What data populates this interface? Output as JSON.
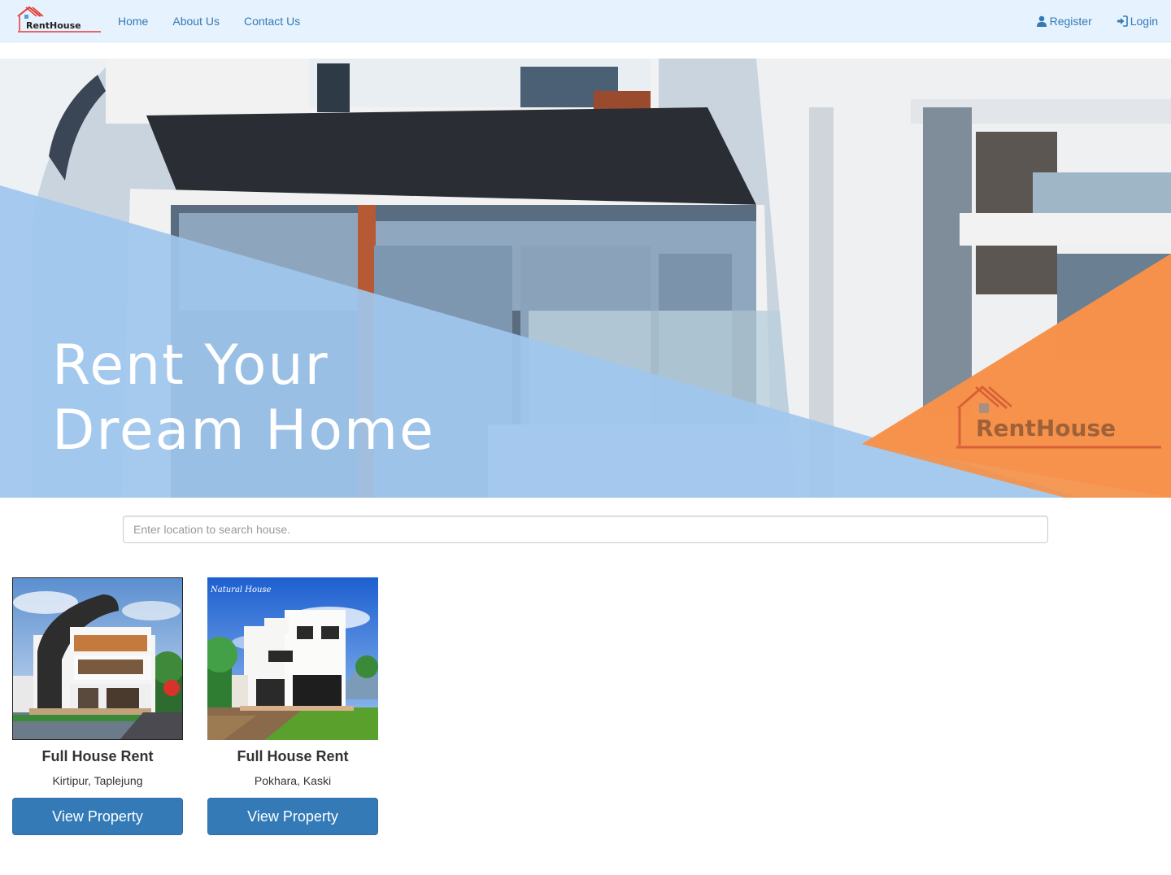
{
  "brand": {
    "name": "RentHouse"
  },
  "nav": {
    "links": [
      {
        "label": "Home"
      },
      {
        "label": "About Us"
      },
      {
        "label": "Contact Us"
      }
    ],
    "register": {
      "label": "Register",
      "icon": "user-icon"
    },
    "login": {
      "label": "Login",
      "icon": "sign-in-icon"
    }
  },
  "hero": {
    "line1": "Rent Your",
    "line2": "Dream Home",
    "logo_text": "RentHouse"
  },
  "search": {
    "placeholder": "Enter location to search house."
  },
  "listings": [
    {
      "title": "Full House Rent",
      "location": "Kirtipur, Taplejung",
      "button": "View Property"
    },
    {
      "title": "Full House Rent",
      "location": "Pokhara, Kaski",
      "button": "View Property",
      "image_caption": "Natural House"
    }
  ],
  "colors": {
    "navbar_bg": "#e6f2fd",
    "link": "#337ab7",
    "button": "#337ab7",
    "hero_blue_overlay": "#9fc7ee",
    "hero_orange_overlay": "#f5914a"
  }
}
